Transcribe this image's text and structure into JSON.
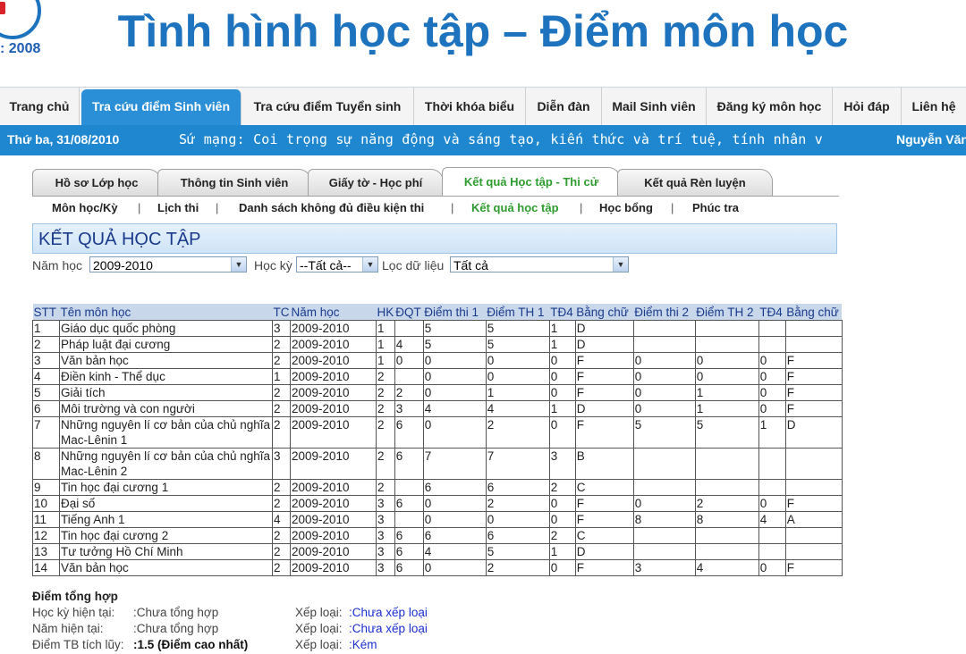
{
  "logo": {
    "year": ": 2008"
  },
  "slide_title": "Tình hình học tập – Điểm môn học",
  "topnav": [
    {
      "label": "Trang chủ",
      "active": false
    },
    {
      "label": "Tra cứu điểm Sinh viên",
      "active": true
    },
    {
      "label": "Tra cứu điểm Tuyển sinh",
      "active": false
    },
    {
      "label": "Thời khóa biểu",
      "active": false
    },
    {
      "label": "Diễn đàn",
      "active": false
    },
    {
      "label": "Mail Sinh viên",
      "active": false
    },
    {
      "label": "Đăng ký môn học",
      "active": false
    },
    {
      "label": "Hỏi đáp",
      "active": false
    },
    {
      "label": "Liên hệ",
      "active": false
    }
  ],
  "infobar": {
    "date": "Thứ ba, 31/08/2010",
    "mission": "Sứ mạng: Coi trọng sự năng động và sáng tạo, kiến thức và trí tuệ, tính nhân v",
    "user": "Nguyễn Văn"
  },
  "tabs": [
    {
      "label": "Hồ sơ Lớp học",
      "active": false
    },
    {
      "label": "Thông tin Sinh viên",
      "active": false
    },
    {
      "label": "Giấy tờ - Học phí",
      "active": false
    },
    {
      "label": "Kết quả Học tập - Thi cử",
      "active": true
    },
    {
      "label": "Kết quả Rèn luyện",
      "active": false
    }
  ],
  "subnav": [
    {
      "label": "Môn học/Kỳ",
      "active": false
    },
    {
      "label": "Lịch thi",
      "active": false
    },
    {
      "label": "Danh sách không đủ điều kiện thi",
      "active": false
    },
    {
      "label": "Kết quả học tập",
      "active": true
    },
    {
      "label": "Học bổng",
      "active": false
    },
    {
      "label": "Phúc tra",
      "active": false
    }
  ],
  "section_title": "KẾT QUẢ HỌC TẬP",
  "filters": {
    "year_label": "Năm học",
    "year_value": "2009-2010",
    "term_label": "Học kỳ",
    "term_value": "--Tất cả--",
    "filter_label": "Lọc dữ liệu",
    "filter_value": "Tất cả"
  },
  "table": {
    "headers": [
      "STT",
      "Tên môn học",
      "TC",
      "Năm học",
      "HK",
      "ĐQT",
      "Điểm thi 1",
      "Điểm TH 1",
      "TĐ4",
      "Bằng chữ",
      "Điểm thi 2",
      "Điểm TH 2",
      "TĐ4",
      "Bằng chữ"
    ],
    "rows": [
      [
        "1",
        "Giáo dục quốc phòng",
        "3",
        "2009-2010",
        "1",
        "",
        "5",
        "5",
        "1",
        "D",
        "",
        "",
        "",
        ""
      ],
      [
        "2",
        "Pháp luật đại cương",
        "2",
        "2009-2010",
        "1",
        "4",
        "5",
        "5",
        "1",
        "D",
        "",
        "",
        "",
        ""
      ],
      [
        "3",
        "Văn bản học",
        "2",
        "2009-2010",
        "1",
        "0",
        "0",
        "0",
        "0",
        "F",
        "0",
        "0",
        "0",
        "F"
      ],
      [
        "4",
        "Điền kinh - Thể dục",
        "1",
        "2009-2010",
        "2",
        "",
        "0",
        "0",
        "0",
        "F",
        "0",
        "0",
        "0",
        "F"
      ],
      [
        "5",
        "Giải tích",
        "2",
        "2009-2010",
        "2",
        "2",
        "0",
        "1",
        "0",
        "F",
        "0",
        "1",
        "0",
        "F"
      ],
      [
        "6",
        "Môi trường và con người",
        "2",
        "2009-2010",
        "2",
        "3",
        "4",
        "4",
        "1",
        "D",
        "0",
        "1",
        "0",
        "F"
      ],
      [
        "7",
        "Những nguyên lí cơ bản của chủ nghĩa Mac-Lênin 1",
        "2",
        "2009-2010",
        "2",
        "6",
        "0",
        "2",
        "0",
        "F",
        "5",
        "5",
        "1",
        "D"
      ],
      [
        "8",
        "Những nguyên lí cơ bản của chủ nghĩa Mac-Lênin 2",
        "3",
        "2009-2010",
        "2",
        "6",
        "7",
        "7",
        "3",
        "B",
        "",
        "",
        "",
        ""
      ],
      [
        "9",
        "Tin học đại cương 1",
        "2",
        "2009-2010",
        "2",
        "",
        "6",
        "6",
        "2",
        "C",
        "",
        "",
        "",
        ""
      ],
      [
        "10",
        "Đại số",
        "2",
        "2009-2010",
        "3",
        "6",
        "0",
        "2",
        "0",
        "F",
        "0",
        "2",
        "0",
        "F"
      ],
      [
        "11",
        "Tiếng Anh 1",
        "4",
        "2009-2010",
        "3",
        "",
        "0",
        "0",
        "0",
        "F",
        "8",
        "8",
        "4",
        "A"
      ],
      [
        "12",
        "Tin học đại cương 2",
        "2",
        "2009-2010",
        "3",
        "6",
        "6",
        "6",
        "2",
        "C",
        "",
        "",
        "",
        ""
      ],
      [
        "13",
        "Tư tưởng Hồ Chí Minh",
        "2",
        "2009-2010",
        "3",
        "6",
        "4",
        "5",
        "1",
        "D",
        "",
        "",
        "",
        ""
      ],
      [
        "14",
        "Văn bản học",
        "2",
        "2009-2010",
        "3",
        "6",
        "0",
        "2",
        "0",
        "F",
        "3",
        "4",
        "0",
        "F"
      ]
    ]
  },
  "summary": {
    "heading": "Điểm tổng hợp",
    "term_label": "Học kỳ hiện tại:",
    "term_value": ":Chưa tổng hợp",
    "year_label": "Năm hiện tại:",
    "year_value": ":Chưa tổng hợp",
    "gpa_label": "Điểm TB tích lũy:",
    "gpa_value": ":1.5 (Điểm cao nhất)",
    "rank_label": "Xếp loại:",
    "rank1": ":Chưa xếp loại",
    "rank2": ":Chưa xếp loại",
    "rank3": ":Kém"
  }
}
